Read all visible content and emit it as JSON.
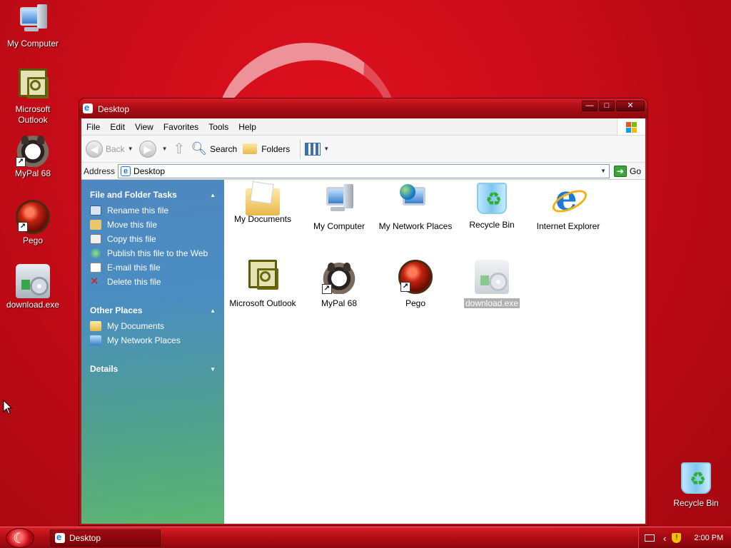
{
  "desktop": {
    "icons": [
      {
        "label": "My Computer",
        "icon": "my-computer-icon"
      },
      {
        "label": "Microsoft Outlook",
        "icon": "outlook-icon"
      },
      {
        "label": "MyPal 68",
        "icon": "mypal-icon"
      },
      {
        "label": "Pego",
        "icon": "pego-icon"
      },
      {
        "label": "download.exe",
        "icon": "setup-exe-icon"
      },
      {
        "label": "Recycle Bin",
        "icon": "recycle-bin-icon"
      }
    ]
  },
  "window": {
    "title": "Desktop",
    "controls": {
      "minimize": "—",
      "maximize": "□",
      "close": "✕"
    },
    "menu": [
      "File",
      "Edit",
      "View",
      "Favorites",
      "Tools",
      "Help"
    ],
    "toolbar": {
      "back": "Back",
      "search": "Search",
      "folders": "Folders"
    },
    "address": {
      "label": "Address",
      "value": "Desktop",
      "go": "Go"
    },
    "taskpane": {
      "file_tasks": {
        "title": "File and Folder Tasks",
        "items": [
          "Rename this file",
          "Move this file",
          "Copy this file",
          "Publish this file to the Web",
          "E-mail this file",
          "Delete this file"
        ]
      },
      "other_places": {
        "title": "Other Places",
        "items": [
          "My Documents",
          "My Network Places"
        ]
      },
      "details": {
        "title": "Details"
      }
    },
    "files": [
      {
        "label": "My Documents",
        "icon": "my-documents-icon"
      },
      {
        "label": "My Computer",
        "icon": "my-computer-icon"
      },
      {
        "label": "My Network Places",
        "icon": "network-places-icon"
      },
      {
        "label": "Recycle Bin",
        "icon": "recycle-bin-icon"
      },
      {
        "label": "Internet Explorer",
        "icon": "internet-explorer-icon"
      },
      {
        "label": "Microsoft Outlook",
        "icon": "outlook-icon"
      },
      {
        "label": "MyPal 68",
        "icon": "mypal-icon"
      },
      {
        "label": "Pego",
        "icon": "pego-icon"
      },
      {
        "label": "download.exe",
        "icon": "setup-exe-icon",
        "selected": true
      }
    ]
  },
  "taskbar": {
    "task": "Desktop",
    "clock": "2:00 PM"
  },
  "colors": {
    "desktop_bg": "#c70c18",
    "title_bar": "#b1141c",
    "taskpane_top": "#4f87c0",
    "taskpane_bottom": "#5cb571"
  }
}
